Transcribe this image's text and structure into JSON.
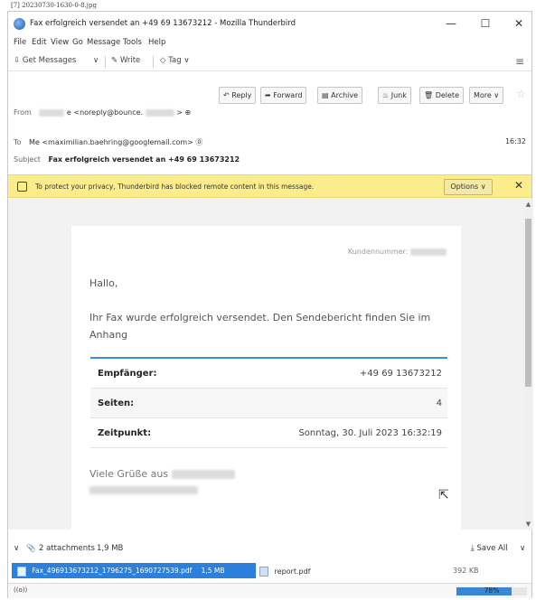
{
  "caption": "[7] 20230730-1630-0-8.jpg",
  "window": {
    "title": "Fax erfolgreich versendet an +49 69 13673212 - Mozilla Thunderbird",
    "minimize": "—",
    "maximize": "☐",
    "close": "✕"
  },
  "menu": [
    "File",
    "Edit",
    "View",
    "Go",
    "Message",
    "Tools",
    "Help"
  ],
  "toolbar": {
    "get_messages": "Get Messages",
    "get_messages_dropdown": "∨",
    "write": "Write",
    "tag": "Tag ∨",
    "menu_icon": "≡"
  },
  "header": {
    "buttons": {
      "reply": "Reply",
      "forward": "Forward",
      "archive": "Archive",
      "junk": "Junk",
      "delete": "Delete",
      "more": "More ∨"
    },
    "star": "☆",
    "from_label": "From",
    "from_value": "e <noreply@bounce.",
    "from_tail": "> ⊕",
    "to_label": "To",
    "to_value": "Me <maximilian.baehring@googlemail.com> ⓪",
    "date": "16:32",
    "subject_label": "Subject",
    "subject_value": "Fax erfolgreich versendet an +49 69 13673212"
  },
  "notice": {
    "text": "To protect your privacy, Thunderbird has blocked remote content in this message.",
    "options": "Options ∨",
    "close": "✕"
  },
  "message": {
    "kundennummer": "Kundennummer:",
    "greeting": "Hallo,",
    "body": "Ihr Fax wurde erfolgreich versendet. Den Sendebericht finden Sie im Anhang",
    "rows": [
      {
        "label": "Empfänger:",
        "value": "+49 69 13673212"
      },
      {
        "label": "Seiten:",
        "value": "4"
      },
      {
        "label": "Zeitpunkt:",
        "value": "Sonntag, 30. Juli 2023 16:32:19"
      }
    ],
    "closing": "Viele Grüße aus"
  },
  "attachments": {
    "toggle": "∨",
    "summary": "2 attachments",
    "size": "1,9 MB",
    "save_all": "Save All",
    "save_all_dropdown": "∨",
    "files": [
      {
        "name": "Fax_496913673212_1796275_1690727539.pdf",
        "size": "1,5 MB"
      },
      {
        "name": "report.pdf",
        "size": "392 KB"
      }
    ]
  },
  "status": {
    "icon_text": "((o))",
    "progress_label": "78%",
    "progress_value": 0.78
  }
}
